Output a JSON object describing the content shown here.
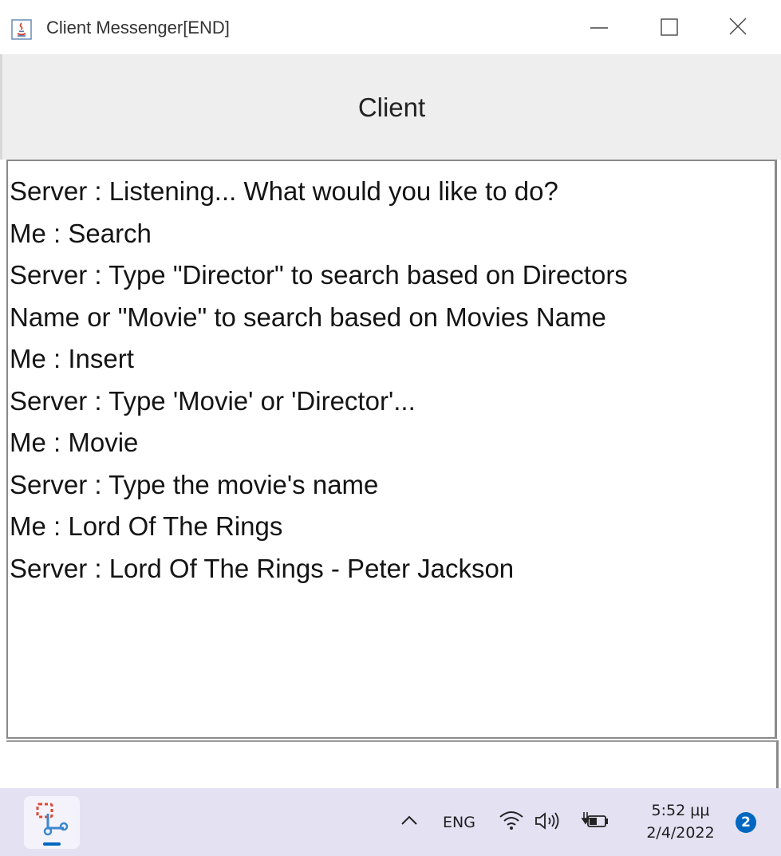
{
  "window": {
    "title": "Client Messenger[END]",
    "controls": {
      "minimize_icon": "minimize-icon",
      "maximize_icon": "maximize-icon",
      "close_icon": "close-icon"
    }
  },
  "header": {
    "title": "Client"
  },
  "chat": {
    "lines": [
      "Server : Listening... What would you like to do?",
      "Me : Search",
      "Server : Type \"Director\" to search based on Directors",
      "Name or \"Movie\" to search based on Movies Name",
      "Me : Insert",
      "Server : Type 'Movie' or 'Director'...",
      "Me : Movie",
      "Server : Type the movie's name",
      "Me : Lord Of The Rings",
      "Server : Lord Of The Rings - Peter Jackson"
    ]
  },
  "input": {
    "value": "",
    "placeholder": ""
  },
  "taskbar": {
    "pinned_app_icon": "snipping-tool-icon",
    "tray": {
      "chevron_icon": "chevron-up-icon",
      "language": "ENG",
      "wifi_icon": "wifi-icon",
      "volume_icon": "volume-icon",
      "battery_icon": "battery-charging-icon"
    },
    "clock": {
      "time": "5:52 μμ",
      "date": "2/4/2022"
    },
    "notification_count": "2",
    "accent_color": "#0067c0"
  }
}
